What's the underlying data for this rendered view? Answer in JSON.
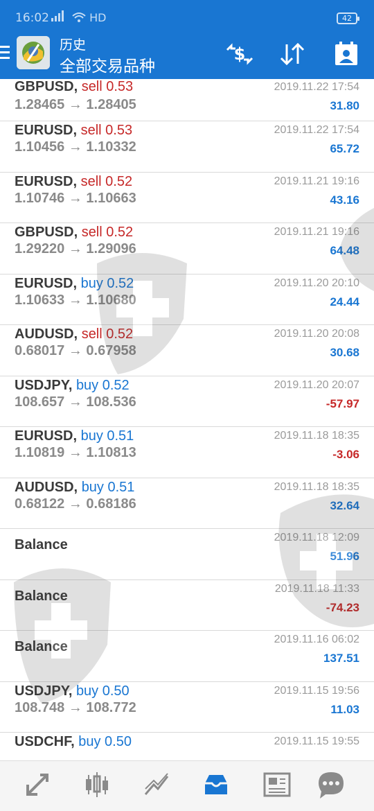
{
  "status": {
    "time": "16:02",
    "signal": "4G",
    "network": "HD",
    "battery": "42"
  },
  "header": {
    "subtitle": "历史",
    "title": "全部交易品种"
  },
  "colors": {
    "primary": "#1976d2",
    "sell": "#c62828",
    "buy": "#1976d2"
  },
  "icons": {
    "menu": "menu-icon",
    "toolbar": [
      "currency-exchange-icon",
      "sort-icon",
      "calendar-icon"
    ],
    "nav": [
      "quotes-icon",
      "chart-icon",
      "trade-icon",
      "history-icon",
      "news-icon",
      "chat-icon"
    ]
  },
  "nav_active": 3,
  "deals": [
    {
      "symbol": "GBPUSD,",
      "side": "sell",
      "volume": "sell 0.53",
      "prices": "1.28465 → 1.28405",
      "time": "2019.11.22 17:54",
      "profit": "31.80",
      "sign": "pos"
    },
    {
      "symbol": "EURUSD,",
      "side": "sell",
      "volume": "sell 0.53",
      "prices": "1.10456 → 1.10332",
      "time": "2019.11.22 17:54",
      "profit": "65.72",
      "sign": "pos"
    },
    {
      "symbol": "EURUSD,",
      "side": "sell",
      "volume": "sell 0.52",
      "prices": "1.10746 → 1.10663",
      "time": "2019.11.21 19:16",
      "profit": "43.16",
      "sign": "pos"
    },
    {
      "symbol": "GBPUSD,",
      "side": "sell",
      "volume": "sell 0.52",
      "prices": "1.29220 → 1.29096",
      "time": "2019.11.21 19:16",
      "profit": "64.48",
      "sign": "pos"
    },
    {
      "symbol": "EURUSD,",
      "side": "buy",
      "volume": "buy 0.52",
      "prices": "1.10633 → 1.10680",
      "time": "2019.11.20 20:10",
      "profit": "24.44",
      "sign": "pos"
    },
    {
      "symbol": "AUDUSD,",
      "side": "sell",
      "volume": "sell 0.52",
      "prices": "0.68017 → 0.67958",
      "time": "2019.11.20 20:08",
      "profit": "30.68",
      "sign": "pos"
    },
    {
      "symbol": "USDJPY,",
      "side": "buy",
      "volume": "buy 0.52",
      "prices": "108.657 → 108.536",
      "time": "2019.11.20 20:07",
      "profit": "-57.97",
      "sign": "neg"
    },
    {
      "symbol": "EURUSD,",
      "side": "buy",
      "volume": "buy 0.51",
      "prices": "1.10819 → 1.10813",
      "time": "2019.11.18 18:35",
      "profit": "-3.06",
      "sign": "neg"
    },
    {
      "symbol": "AUDUSD,",
      "side": "buy",
      "volume": "buy 0.51",
      "prices": "0.68122 → 0.68186",
      "time": "2019.11.18 18:35",
      "profit": "32.64",
      "sign": "pos"
    },
    {
      "symbol": "Balance",
      "side": "",
      "volume": "",
      "prices": "",
      "time": "2019.11.18 12:09",
      "profit": "51.96",
      "sign": "pos"
    },
    {
      "symbol": "Balance",
      "side": "",
      "volume": "",
      "prices": "",
      "time": "2019.11.18 11:33",
      "profit": "-74.23",
      "sign": "neg"
    },
    {
      "symbol": "Balance",
      "side": "",
      "volume": "",
      "prices": "",
      "time": "2019.11.16 06:02",
      "profit": "137.51",
      "sign": "pos"
    },
    {
      "symbol": "USDJPY,",
      "side": "buy",
      "volume": "buy 0.50",
      "prices": "108.748 → 108.772",
      "time": "2019.11.15 19:56",
      "profit": "11.03",
      "sign": "pos"
    },
    {
      "symbol": "USDCHF,",
      "side": "buy",
      "volume": "buy 0.50",
      "prices": "",
      "time": "2019.11.15 19:55",
      "profit": "",
      "sign": "pos"
    }
  ]
}
